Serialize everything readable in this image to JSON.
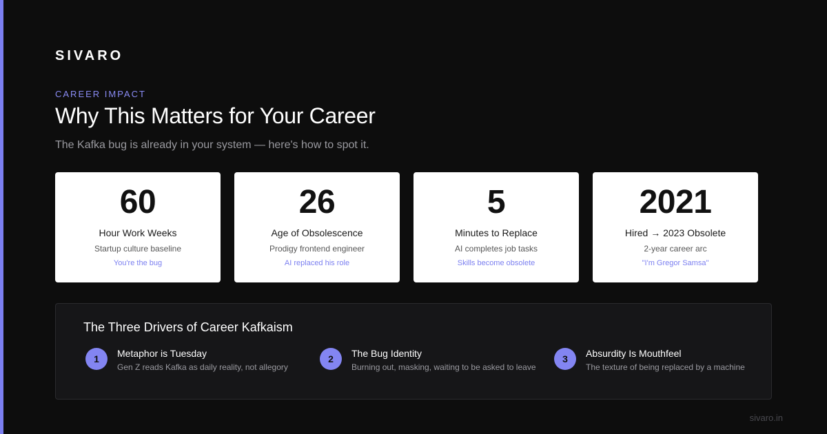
{
  "brand": "SIVARO",
  "eyebrow": "CAREER IMPACT",
  "title": "Why This Matters for Your Career",
  "subtitle": "The Kafka bug is already in your system — here's how to spot it.",
  "stats": [
    {
      "number": "60",
      "label": "Hour Work Weeks",
      "sub": "Startup culture baseline",
      "note": "You're the bug"
    },
    {
      "number": "26",
      "label": "Age of Obsolescence",
      "sub": "Prodigy frontend engineer",
      "note": "AI replaced his role"
    },
    {
      "number": "5",
      "label": "Minutes to Replace",
      "sub": "AI completes job tasks",
      "note": "Skills become obsolete"
    },
    {
      "number": "2021",
      "label": "Hired → 2023 Obsolete",
      "sub": "2-year career arc",
      "note": "\"I'm Gregor Samsa\""
    }
  ],
  "drivers": {
    "title": "The Three Drivers of Career Kafkaism",
    "items": [
      {
        "num": "1",
        "title": "Metaphor is Tuesday",
        "desc": "Gen Z reads Kafka as daily reality, not allegory"
      },
      {
        "num": "2",
        "title": "The Bug Identity",
        "desc": "Burning out, masking, waiting to be asked to leave"
      },
      {
        "num": "3",
        "title": "Absurdity Is Mouthfeel",
        "desc": "The texture of being replaced by a machine"
      }
    ]
  },
  "footer": "sivaro.in",
  "colors": {
    "accent": "#7b7ff0",
    "background": "#0d0d0d",
    "card": "#ffffff"
  }
}
